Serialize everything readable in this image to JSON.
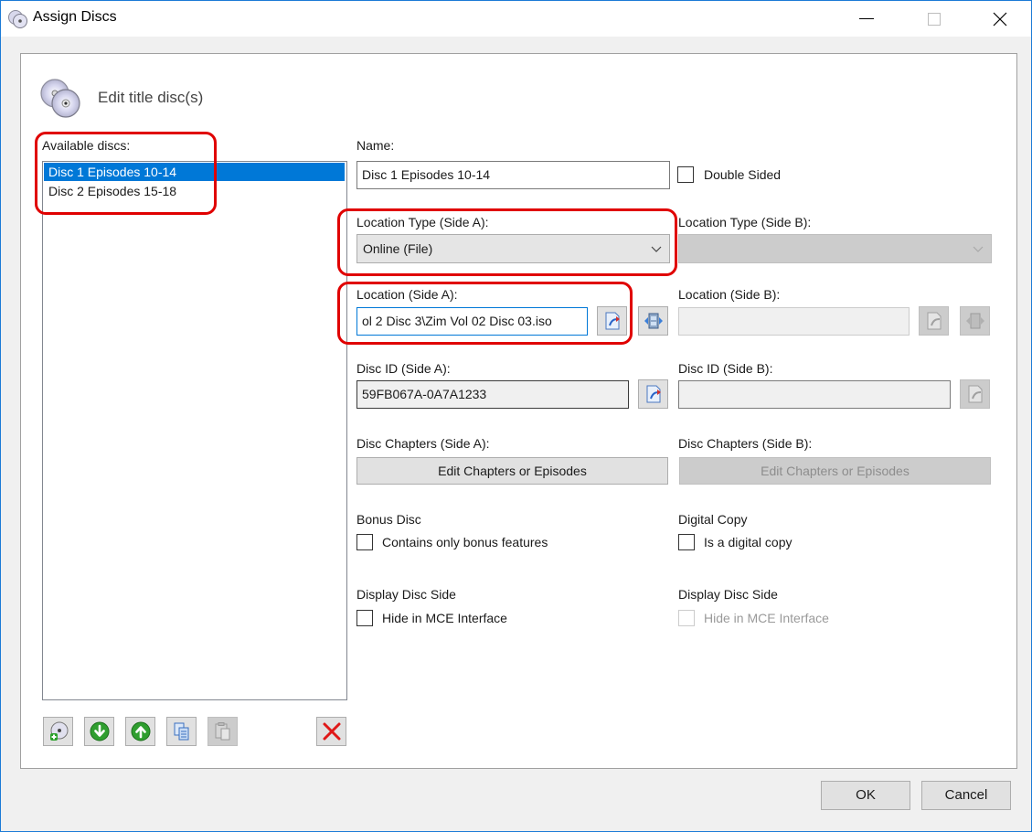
{
  "window": {
    "title": "Assign Discs",
    "minimize_label": "Minimize",
    "maximize_label": "Maximize",
    "close_label": "Close"
  },
  "header": {
    "title": "Edit title disc(s)",
    "icon": "discs-icon"
  },
  "discs_list": {
    "label": "Available discs:",
    "items": [
      {
        "label": "Disc 1 Episodes 10-14",
        "selected": true
      },
      {
        "label": "Disc 2 Episodes 15-18",
        "selected": false
      }
    ]
  },
  "list_toolbar": {
    "buttons": [
      {
        "name": "add-disc",
        "icon": "add-disc-icon",
        "enabled": true
      },
      {
        "name": "move-down",
        "icon": "arrow-down-icon",
        "enabled": true
      },
      {
        "name": "move-up",
        "icon": "arrow-up-icon",
        "enabled": true
      },
      {
        "name": "copy",
        "icon": "copy-icon",
        "enabled": true
      },
      {
        "name": "paste",
        "icon": "paste-icon",
        "enabled": false
      },
      {
        "name": "delete",
        "icon": "delete-icon",
        "enabled": true
      }
    ]
  },
  "form": {
    "name_label": "Name:",
    "name_value": "Disc 1 Episodes 10-14",
    "double_sided_label": "Double Sided",
    "double_sided_checked": false,
    "side_a": {
      "location_type_label": "Location Type (Side A):",
      "location_type_value": "Online (File)",
      "location_label": "Location (Side A):",
      "location_value": "ol 2 Disc 3\\Zim Vol 02 Disc 03.iso",
      "disc_id_label": "Disc ID (Side A):",
      "disc_id_value": "59FB067A-0A7A1233",
      "chapters_label": "Disc Chapters (Side A):",
      "chapters_button": "Edit Chapters or Episodes"
    },
    "side_b": {
      "location_type_label": "Location Type (Side B):",
      "location_type_value": "",
      "location_label": "Location (Side B):",
      "location_value": "",
      "disc_id_label": "Disc ID (Side B):",
      "disc_id_value": "",
      "chapters_label": "Disc Chapters (Side B):",
      "chapters_button": "Edit Chapters or Episodes"
    },
    "bonus_disc_label": "Bonus Disc",
    "bonus_checkbox_label": "Contains only bonus features",
    "bonus_checked": false,
    "digital_copy_label": "Digital Copy",
    "digital_copy_checkbox_label": "Is a digital copy",
    "digital_copy_checked": false,
    "display_side_a_label": "Display Disc Side",
    "hide_mce_a_label": "Hide in MCE Interface",
    "hide_mce_a_checked": false,
    "display_side_b_label": "Display Disc Side",
    "hide_mce_b_label": "Hide in MCE Interface",
    "hide_mce_b_checked": false
  },
  "footer": {
    "ok_label": "OK",
    "cancel_label": "Cancel"
  },
  "colors": {
    "accent": "#0078d7",
    "highlight": "#e00000",
    "window_border": "#1c7bd6"
  }
}
